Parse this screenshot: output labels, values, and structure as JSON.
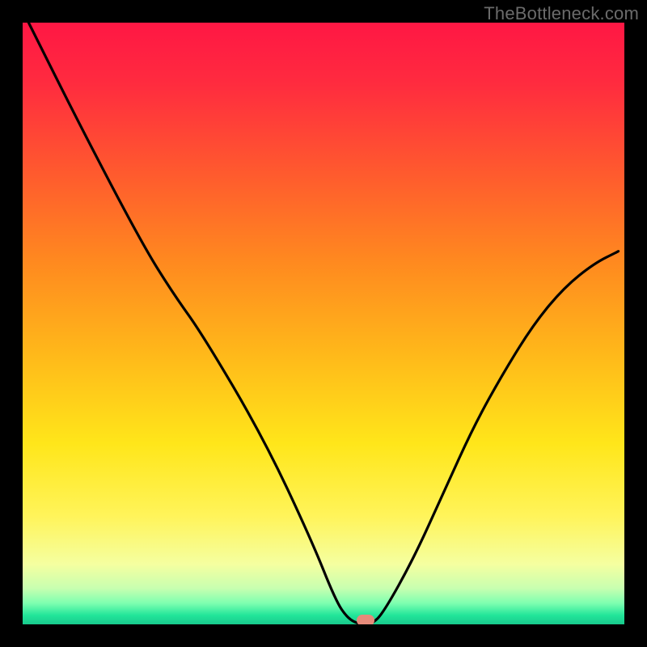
{
  "watermark": {
    "text": "TheBottleneck.com"
  },
  "colors": {
    "black": "#000000",
    "curve": "#000000",
    "marker": "#e68a7a",
    "gradient_stops": [
      {
        "pos": 0.0,
        "color": "#ff1744"
      },
      {
        "pos": 0.1,
        "color": "#ff2b3f"
      },
      {
        "pos": 0.25,
        "color": "#ff5a2e"
      },
      {
        "pos": 0.4,
        "color": "#ff8a1f"
      },
      {
        "pos": 0.55,
        "color": "#ffb81a"
      },
      {
        "pos": 0.7,
        "color": "#ffe61a"
      },
      {
        "pos": 0.82,
        "color": "#fff45a"
      },
      {
        "pos": 0.9,
        "color": "#f5ffa0"
      },
      {
        "pos": 0.94,
        "color": "#c8ffb0"
      },
      {
        "pos": 0.965,
        "color": "#7dffb0"
      },
      {
        "pos": 0.985,
        "color": "#22e59a"
      },
      {
        "pos": 1.0,
        "color": "#18c98c"
      }
    ]
  },
  "chart_data": {
    "type": "line",
    "title": "",
    "xlabel": "",
    "ylabel": "",
    "xlim": [
      0,
      100
    ],
    "ylim": [
      0,
      100
    ],
    "series": [
      {
        "name": "bottleneck-curve",
        "x": [
          1,
          10,
          20,
          25,
          30,
          40,
          48,
          52,
          54,
          56,
          58,
          60,
          65,
          70,
          75,
          80,
          85,
          90,
          95,
          99
        ],
        "values": [
          100,
          82,
          63,
          55,
          48,
          31,
          14,
          4,
          1,
          0,
          0,
          2,
          11,
          22,
          33,
          42,
          50,
          56,
          60,
          62
        ]
      }
    ],
    "annotations": [
      {
        "name": "min-marker",
        "x": 57,
        "y": 0.7
      }
    ]
  }
}
